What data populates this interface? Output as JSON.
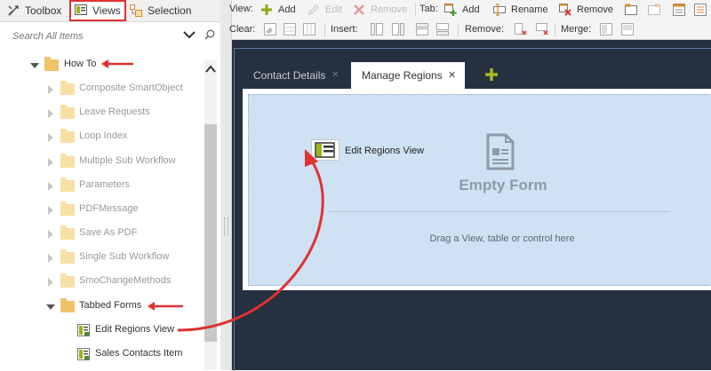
{
  "panel_tabs": [
    {
      "label": "Toolbox",
      "icon": "wrench-icon"
    },
    {
      "label": "Views",
      "icon": "view-icon"
    },
    {
      "label": "Selection",
      "icon": "selection-icon"
    }
  ],
  "search": {
    "placeholder": "Search All Items"
  },
  "tree": {
    "items": [
      {
        "label": "How To",
        "level": 0,
        "expanded": true,
        "kind": "folder"
      },
      {
        "label": "Composite SmartObject",
        "level": 1,
        "expanded": false,
        "kind": "folder"
      },
      {
        "label": "Leave Requests",
        "level": 1,
        "expanded": false,
        "kind": "folder"
      },
      {
        "label": "Loop Index",
        "level": 1,
        "expanded": false,
        "kind": "folder"
      },
      {
        "label": "Multiple Sub Workflow",
        "level": 1,
        "expanded": false,
        "kind": "folder"
      },
      {
        "label": "Parameters",
        "level": 1,
        "expanded": false,
        "kind": "folder"
      },
      {
        "label": "PDFMessage",
        "level": 1,
        "expanded": false,
        "kind": "folder"
      },
      {
        "label": "Save As PDF",
        "level": 1,
        "expanded": false,
        "kind": "folder"
      },
      {
        "label": "Single Sub Workflow",
        "level": 1,
        "expanded": false,
        "kind": "folder"
      },
      {
        "label": "SmoChangeMethods",
        "level": 1,
        "expanded": false,
        "kind": "folder"
      },
      {
        "label": "Tabbed Forms",
        "level": 1,
        "expanded": true,
        "kind": "folder"
      },
      {
        "label": "Edit Regions View",
        "level": 2,
        "kind": "view"
      },
      {
        "label": "Sales Contacts Item",
        "level": 2,
        "kind": "view"
      }
    ]
  },
  "toolbar": {
    "view_label": "View:",
    "view_add": "Add",
    "view_edit": "Edit",
    "view_remove": "Remove",
    "tab_label": "Tab:",
    "tab_add": "Add",
    "tab_rename": "Rename",
    "tab_remove": "Remove",
    "clear_label": "Clear:",
    "insert_label": "Insert:",
    "remove_label": "Remove:",
    "merge_label": "Merge:"
  },
  "form": {
    "tabs": [
      {
        "label": "Contact Details",
        "active": false
      },
      {
        "label": "Manage Regions",
        "active": true
      }
    ],
    "dropped_view_label": "Edit Regions View",
    "empty_title": "Empty Form",
    "drop_hint": "Drag a View, table or control here"
  },
  "colors": {
    "annotation_red": "#e03131",
    "canvas_bg": "#253040",
    "drop_zone_bg": "#cfe2f3",
    "folder": "#f7dfa6"
  }
}
